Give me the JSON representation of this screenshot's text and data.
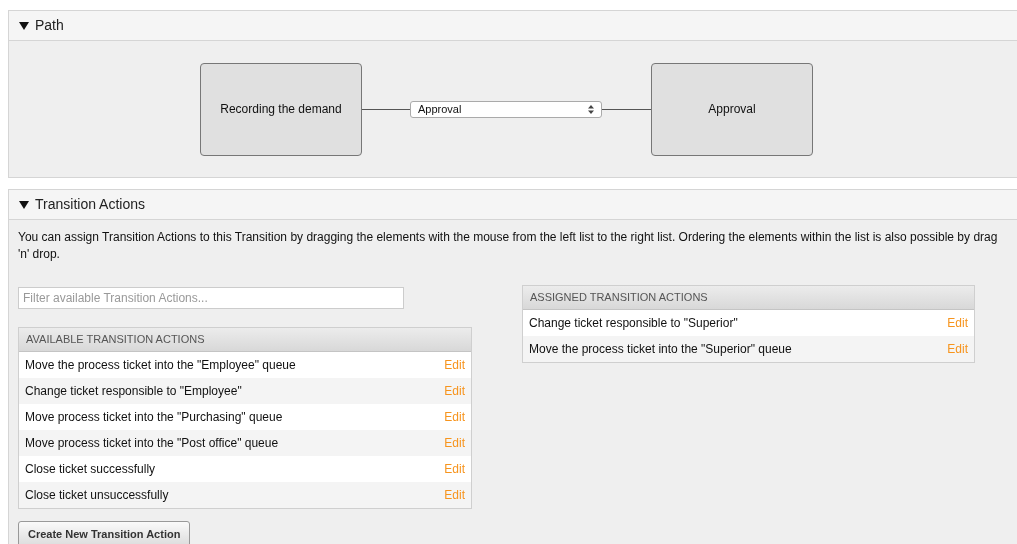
{
  "path_panel": {
    "title": "Path",
    "expanded": true,
    "from_node": "Recording the demand",
    "transition_select": {
      "value": "Approval"
    },
    "to_node": "Approval"
  },
  "actions_panel": {
    "title": "Transition Actions",
    "expanded": true,
    "description": "You can assign Transition Actions to this Transition by dragging the elements with the mouse from the left list to the right list. Ordering the elements within the list is also possible by drag 'n' drop.",
    "filter": {
      "placeholder": "Filter available Transition Actions..."
    },
    "available": {
      "title": "AVAILABLE TRANSITION ACTIONS",
      "items": [
        {
          "label": "Move the process ticket into the \"Employee\" queue",
          "action": "Edit"
        },
        {
          "label": "Change ticket responsible to \"Employee\"",
          "action": "Edit"
        },
        {
          "label": "Move process ticket into the \"Purchasing\" queue",
          "action": "Edit"
        },
        {
          "label": "Move process ticket into the \"Post office\" queue",
          "action": "Edit"
        },
        {
          "label": "Close ticket successfully",
          "action": "Edit"
        },
        {
          "label": "Close ticket unsuccessfully",
          "action": "Edit"
        }
      ]
    },
    "assigned": {
      "title": "ASSIGNED TRANSITION ACTIONS",
      "items": [
        {
          "label": "Change ticket responsible to \"Superior\"",
          "action": "Edit"
        },
        {
          "label": "Move the process ticket into the \"Superior\" queue",
          "action": "Edit"
        }
      ]
    },
    "create_button": "Create New Transition Action"
  }
}
